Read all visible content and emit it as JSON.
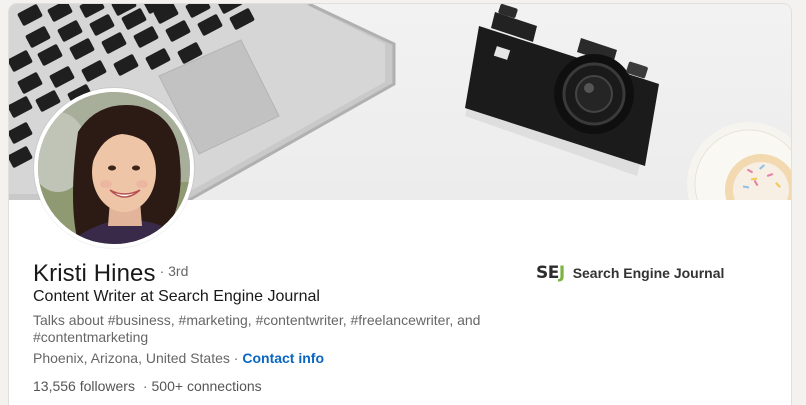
{
  "profile": {
    "name": "Kristi Hines",
    "degree": "· 3rd",
    "headline": "Content Writer at Search Engine Journal",
    "talks_about": "Talks about #business, #marketing, #contentwriter, #freelancewriter, and #contentmarketing",
    "location": "Phoenix, Arizona, United States",
    "location_sep": "·",
    "contact_info": "Contact info",
    "followers": "13,556 followers",
    "stats_sep": "·",
    "connections": "500+ connections"
  },
  "company": {
    "logo_text_main": "SE",
    "logo_text_accent": "J",
    "name": "Search Engine Journal"
  },
  "colors": {
    "link": "#0a66c2",
    "logo_accent": "#7cb342"
  }
}
